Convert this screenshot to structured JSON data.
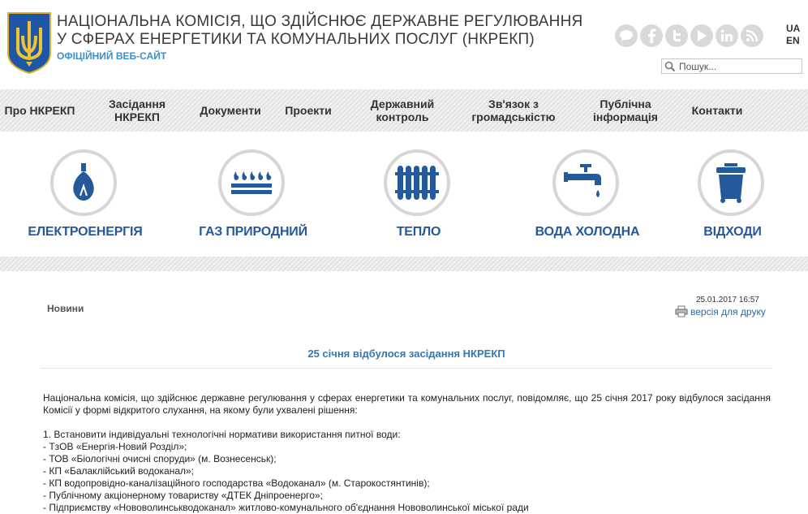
{
  "header": {
    "title_line1": "НАЦІОНАЛЬНА КОМІСІЯ, ЩО ЗДІЙСНЮЄ ДЕРЖАВНЕ РЕГУЛЮВАННЯ",
    "title_line2": "У СФЕРАХ ЕНЕРГЕТИКИ ТА КОМУНАЛЬНИХ ПОСЛУГ (НКРЕКП)",
    "subtitle": "ОФІЦІЙНИЙ ВЕБ-САЙТ",
    "logo_icon": "trident-coat-of-arms-icon",
    "socials": [
      "chat-icon",
      "facebook-icon",
      "twitter-icon",
      "youtube-icon",
      "linkedin-icon",
      "rss-icon"
    ],
    "lang_ua": "UA",
    "lang_en": "EN",
    "search_placeholder": "Пошук..."
  },
  "nav": [
    "Про НКРЕКП",
    "Засідання НКРЕКП",
    "Документи",
    "Проекти",
    "Державний контроль",
    "Зв'язок з громадськістю",
    "Публічна інформація",
    "Контакти"
  ],
  "categories": [
    {
      "label": "ЕЛЕКТРОЕНЕРГІЯ",
      "icon": "lightbulb-icon"
    },
    {
      "label": "ГАЗ ПРИРОДНИЙ",
      "icon": "gas-burner-icon"
    },
    {
      "label": "ТЕПЛО",
      "icon": "radiator-icon"
    },
    {
      "label": "ВОДА ХОЛОДНА",
      "icon": "water-tap-icon"
    },
    {
      "label": "ВІДХОДИ",
      "icon": "trash-bin-icon"
    }
  ],
  "colors": {
    "accent": "#245a9c",
    "link": "#2a6aa8",
    "subtitle": "#3a90c8",
    "icon_circle": "#d6d6d6"
  },
  "breadcrumb": "Новини",
  "date": "25.01.2017 16:57",
  "print_label": "версія для друку",
  "article": {
    "title": "25 січня відбулося засідання НКРЕКП",
    "intro": "Національна комісія, що здійснює державне регулювання у сферах енергетики та комунальних послуг, повідомляє, що 25 січня 2017 року відбулося засідання Комісії у формі відкритого слухання, на якому були ухвалені рішення:",
    "lines": [
      "1. Встановити індивідуальні технологічні нормативи використання питної води:",
      "- ТзОВ «Енергія-Новий Розділ»;",
      "- ТОВ «Біологічні очисні споруди» (м. Вознесенськ);",
      "- КП «Балаклійський водоканал»;",
      "- КП водопровідно-каналізаційного господарства «Водоканал» (м. Старокостянтинів);",
      "- Публічному акціонерному товариству «ДТЕК Дніпроенерго»;",
      "- Підприємству «Нововолинськводоканал» житлово-комунального об'єднання Нововолинської міської ради"
    ]
  }
}
